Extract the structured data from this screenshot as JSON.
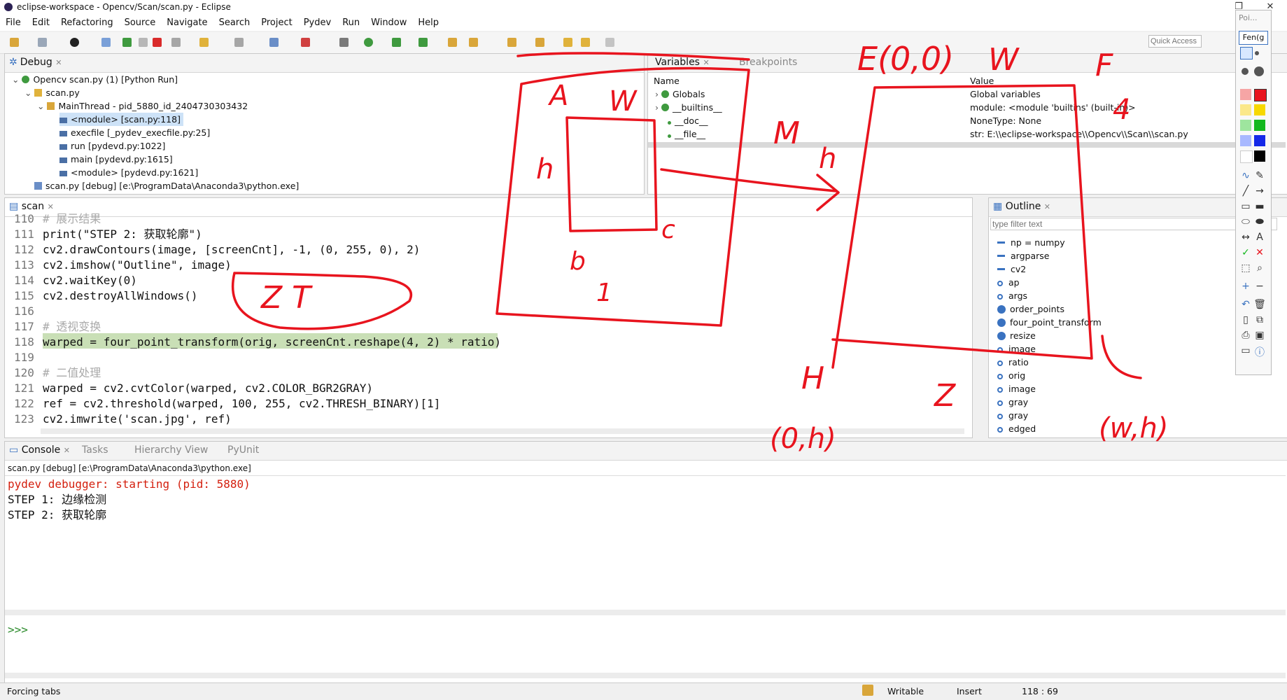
{
  "window": {
    "title": "eclipse-workspace - Opencv/Scan/scan.py - Eclipse",
    "restore": "❐",
    "close": "✕"
  },
  "menu": [
    "File",
    "Edit",
    "Refactoring",
    "Source",
    "Navigate",
    "Search",
    "Project",
    "Pydev",
    "Run",
    "Window",
    "Help"
  ],
  "quick_access": {
    "placeholder": "Quick Access"
  },
  "debug": {
    "tab": "Debug",
    "rows": [
      "Opencv scan.py (1) [Python Run]",
      "scan.py",
      "MainThread - pid_5880_id_2404730303432",
      "<module> [scan.py:118]",
      "execfile [_pydev_execfile.py:25]",
      "run [pydevd.py:1022]",
      "main [pydevd.py:1615]",
      "<module> [pydevd.py:1621]",
      "scan.py [debug] [e:\\ProgramData\\Anaconda3\\python.exe]"
    ]
  },
  "variables": {
    "tabs": [
      "Variables",
      "Breakpoints"
    ],
    "columns": [
      "Name",
      "Value"
    ],
    "rows": [
      {
        "name": "Globals",
        "value": "Global variables"
      },
      {
        "name": "__builtins__",
        "value": "module: <module 'builtins' (built-in)>"
      },
      {
        "name": "__doc__",
        "value": "NoneType: None"
      },
      {
        "name": "__file__",
        "value": "str: E:\\\\eclipse-workspace\\\\Opencv\\\\Scan\\\\scan.py"
      }
    ]
  },
  "editor": {
    "tab": "scan",
    "lines": [
      {
        "n": "110",
        "text": "# 展示结果"
      },
      {
        "n": "111",
        "text": "print(\"STEP 2: 获取轮廓\")"
      },
      {
        "n": "112",
        "text": "cv2.drawContours(image, [screenCnt], -1, (0, 255, 0), 2)"
      },
      {
        "n": "113",
        "text": "cv2.imshow(\"Outline\", image)"
      },
      {
        "n": "114",
        "text": "cv2.waitKey(0)"
      },
      {
        "n": "115",
        "text": "cv2.destroyAllWindows()"
      },
      {
        "n": "116",
        "text": ""
      },
      {
        "n": "117",
        "text": "# 透视变换"
      },
      {
        "n": "118",
        "text": "warped = four_point_transform(orig, screenCnt.reshape(4, 2) * ratio)"
      },
      {
        "n": "119",
        "text": ""
      },
      {
        "n": "120",
        "text": "# 二值处理"
      },
      {
        "n": "121",
        "text": "warped = cv2.cvtColor(warped, cv2.COLOR_BGR2GRAY)"
      },
      {
        "n": "122",
        "text": "ref = cv2.threshold(warped, 100, 255, cv2.THRESH_BINARY)[1]"
      },
      {
        "n": "123",
        "text": "cv2.imwrite('scan.jpg', ref)"
      }
    ]
  },
  "outline": {
    "tab": "Outline",
    "filter_placeholder": "type filter text",
    "items": [
      {
        "kind": "import",
        "label": "np = numpy"
      },
      {
        "kind": "import",
        "label": "argparse"
      },
      {
        "kind": "import",
        "label": "cv2"
      },
      {
        "kind": "var",
        "label": "ap"
      },
      {
        "kind": "var",
        "label": "args"
      },
      {
        "kind": "func",
        "label": "order_points"
      },
      {
        "kind": "func",
        "label": "four_point_transform"
      },
      {
        "kind": "func",
        "label": "resize"
      },
      {
        "kind": "var",
        "label": "image"
      },
      {
        "kind": "var",
        "label": "ratio"
      },
      {
        "kind": "var",
        "label": "orig"
      },
      {
        "kind": "var",
        "label": "image"
      },
      {
        "kind": "var",
        "label": "gray"
      },
      {
        "kind": "var",
        "label": "gray"
      },
      {
        "kind": "var",
        "label": "edged"
      }
    ]
  },
  "console": {
    "tabs": [
      "Console",
      "Tasks",
      "Hierarchy View",
      "PyUnit"
    ],
    "header": "scan.py [debug] [e:\\ProgramData\\Anaconda3\\python.exe]",
    "lines": [
      "pydev debugger: starting (pid: 5880)",
      "STEP 1: 边缘检测",
      "STEP 2: 获取轮廓"
    ],
    "prompt": ">>>"
  },
  "status": {
    "left": "Forcing tabs",
    "writable": "Writable",
    "insert": "Insert",
    "position": "118 : 69"
  },
  "palette": {
    "title": "Poi...",
    "active_tool": "Fen(g"
  },
  "annotations": [
    "A",
    "W",
    "h",
    "b",
    "c",
    "1",
    "Z T",
    "E(0,0)",
    "W",
    "F",
    "M",
    "h",
    "H",
    "Z",
    "(0,h)",
    "(w,h)",
    "4"
  ],
  "colors": {
    "ink": "#e8141e",
    "highlight": "#c9dfb6",
    "console_err": "#d4200f"
  }
}
